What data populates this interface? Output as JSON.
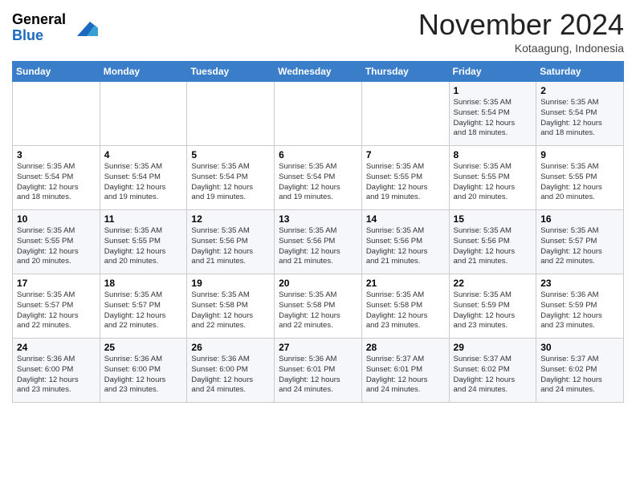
{
  "header": {
    "logo_general": "General",
    "logo_blue": "Blue",
    "month_title": "November 2024",
    "subtitle": "Kotaagung, Indonesia"
  },
  "weekdays": [
    "Sunday",
    "Monday",
    "Tuesday",
    "Wednesday",
    "Thursday",
    "Friday",
    "Saturday"
  ],
  "weeks": [
    [
      {
        "day": "",
        "info": ""
      },
      {
        "day": "",
        "info": ""
      },
      {
        "day": "",
        "info": ""
      },
      {
        "day": "",
        "info": ""
      },
      {
        "day": "",
        "info": ""
      },
      {
        "day": "1",
        "info": "Sunrise: 5:35 AM\nSunset: 5:54 PM\nDaylight: 12 hours\nand 18 minutes."
      },
      {
        "day": "2",
        "info": "Sunrise: 5:35 AM\nSunset: 5:54 PM\nDaylight: 12 hours\nand 18 minutes."
      }
    ],
    [
      {
        "day": "3",
        "info": "Sunrise: 5:35 AM\nSunset: 5:54 PM\nDaylight: 12 hours\nand 18 minutes."
      },
      {
        "day": "4",
        "info": "Sunrise: 5:35 AM\nSunset: 5:54 PM\nDaylight: 12 hours\nand 19 minutes."
      },
      {
        "day": "5",
        "info": "Sunrise: 5:35 AM\nSunset: 5:54 PM\nDaylight: 12 hours\nand 19 minutes."
      },
      {
        "day": "6",
        "info": "Sunrise: 5:35 AM\nSunset: 5:54 PM\nDaylight: 12 hours\nand 19 minutes."
      },
      {
        "day": "7",
        "info": "Sunrise: 5:35 AM\nSunset: 5:55 PM\nDaylight: 12 hours\nand 19 minutes."
      },
      {
        "day": "8",
        "info": "Sunrise: 5:35 AM\nSunset: 5:55 PM\nDaylight: 12 hours\nand 20 minutes."
      },
      {
        "day": "9",
        "info": "Sunrise: 5:35 AM\nSunset: 5:55 PM\nDaylight: 12 hours\nand 20 minutes."
      }
    ],
    [
      {
        "day": "10",
        "info": "Sunrise: 5:35 AM\nSunset: 5:55 PM\nDaylight: 12 hours\nand 20 minutes."
      },
      {
        "day": "11",
        "info": "Sunrise: 5:35 AM\nSunset: 5:55 PM\nDaylight: 12 hours\nand 20 minutes."
      },
      {
        "day": "12",
        "info": "Sunrise: 5:35 AM\nSunset: 5:56 PM\nDaylight: 12 hours\nand 21 minutes."
      },
      {
        "day": "13",
        "info": "Sunrise: 5:35 AM\nSunset: 5:56 PM\nDaylight: 12 hours\nand 21 minutes."
      },
      {
        "day": "14",
        "info": "Sunrise: 5:35 AM\nSunset: 5:56 PM\nDaylight: 12 hours\nand 21 minutes."
      },
      {
        "day": "15",
        "info": "Sunrise: 5:35 AM\nSunset: 5:56 PM\nDaylight: 12 hours\nand 21 minutes."
      },
      {
        "day": "16",
        "info": "Sunrise: 5:35 AM\nSunset: 5:57 PM\nDaylight: 12 hours\nand 22 minutes."
      }
    ],
    [
      {
        "day": "17",
        "info": "Sunrise: 5:35 AM\nSunset: 5:57 PM\nDaylight: 12 hours\nand 22 minutes."
      },
      {
        "day": "18",
        "info": "Sunrise: 5:35 AM\nSunset: 5:57 PM\nDaylight: 12 hours\nand 22 minutes."
      },
      {
        "day": "19",
        "info": "Sunrise: 5:35 AM\nSunset: 5:58 PM\nDaylight: 12 hours\nand 22 minutes."
      },
      {
        "day": "20",
        "info": "Sunrise: 5:35 AM\nSunset: 5:58 PM\nDaylight: 12 hours\nand 22 minutes."
      },
      {
        "day": "21",
        "info": "Sunrise: 5:35 AM\nSunset: 5:58 PM\nDaylight: 12 hours\nand 23 minutes."
      },
      {
        "day": "22",
        "info": "Sunrise: 5:35 AM\nSunset: 5:59 PM\nDaylight: 12 hours\nand 23 minutes."
      },
      {
        "day": "23",
        "info": "Sunrise: 5:36 AM\nSunset: 5:59 PM\nDaylight: 12 hours\nand 23 minutes."
      }
    ],
    [
      {
        "day": "24",
        "info": "Sunrise: 5:36 AM\nSunset: 6:00 PM\nDaylight: 12 hours\nand 23 minutes."
      },
      {
        "day": "25",
        "info": "Sunrise: 5:36 AM\nSunset: 6:00 PM\nDaylight: 12 hours\nand 23 minutes."
      },
      {
        "day": "26",
        "info": "Sunrise: 5:36 AM\nSunset: 6:00 PM\nDaylight: 12 hours\nand 24 minutes."
      },
      {
        "day": "27",
        "info": "Sunrise: 5:36 AM\nSunset: 6:01 PM\nDaylight: 12 hours\nand 24 minutes."
      },
      {
        "day": "28",
        "info": "Sunrise: 5:37 AM\nSunset: 6:01 PM\nDaylight: 12 hours\nand 24 minutes."
      },
      {
        "day": "29",
        "info": "Sunrise: 5:37 AM\nSunset: 6:02 PM\nDaylight: 12 hours\nand 24 minutes."
      },
      {
        "day": "30",
        "info": "Sunrise: 5:37 AM\nSunset: 6:02 PM\nDaylight: 12 hours\nand 24 minutes."
      }
    ]
  ]
}
